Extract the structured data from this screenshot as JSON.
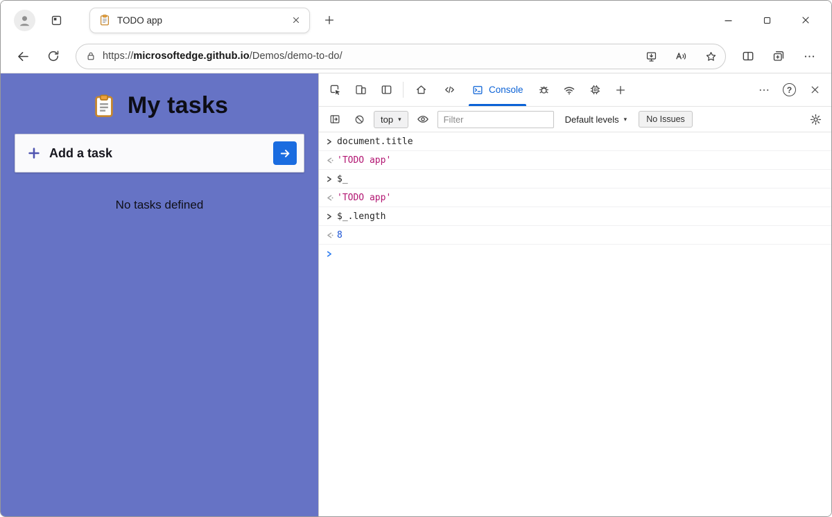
{
  "browser": {
    "tab_title": "TODO app",
    "address": {
      "scheme": "https://",
      "host": "microsoftedge.github.io",
      "path": "/Demos/demo-to-do/"
    }
  },
  "app": {
    "title": "My tasks",
    "add_task_label": "Add a task",
    "empty_message": "No tasks defined"
  },
  "devtools": {
    "console_tab_label": "Console",
    "toolbar": {
      "context_label": "top",
      "filter_placeholder": "Filter",
      "levels_label": "Default levels",
      "issues_label": "No Issues"
    },
    "console": {
      "entries": [
        {
          "kind": "command",
          "text": "document.title"
        },
        {
          "kind": "result-string",
          "text": "'TODO app'"
        },
        {
          "kind": "command",
          "text": "$_"
        },
        {
          "kind": "result-string",
          "text": "'TODO app'"
        },
        {
          "kind": "command",
          "text": "$_.length"
        },
        {
          "kind": "result-number",
          "text": "8"
        }
      ]
    }
  },
  "glyphs": {
    "caret_down": "▾",
    "help": "?"
  },
  "colors": {
    "app_background": "#6673c5",
    "add_button_blue": "#1a6ce0",
    "devtools_accent": "#0b62d6",
    "console_string": "#b21672",
    "console_number": "#1a53d5"
  }
}
